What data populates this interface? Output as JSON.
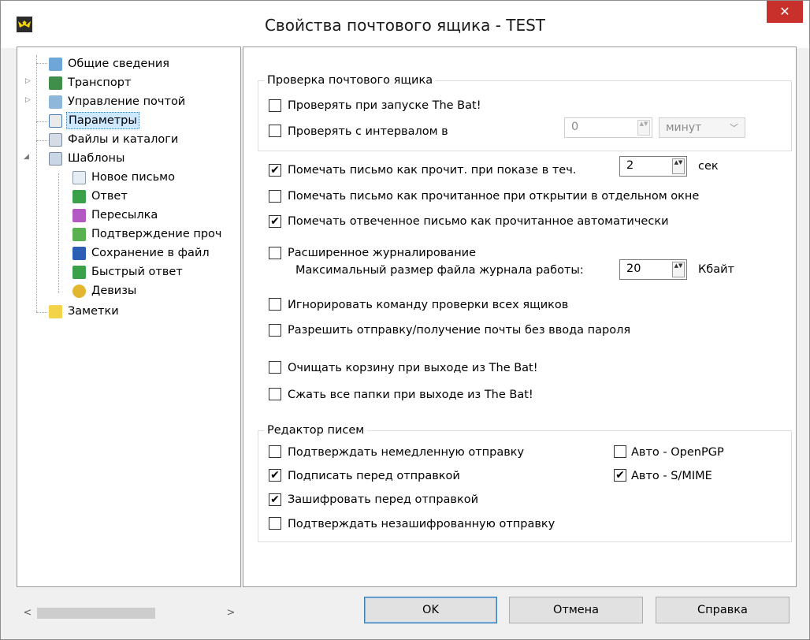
{
  "window": {
    "title": "Свойства почтового ящика - TEST",
    "close_glyph": "✕",
    "accent_close": "#c7302b"
  },
  "tree": {
    "items": [
      {
        "label": "Общие сведения",
        "icon": "general-info-icon"
      },
      {
        "label": "Транспорт",
        "icon": "transport-icon",
        "expander": "▷"
      },
      {
        "label": "Управление почтой",
        "icon": "mail-management-icon",
        "expander": "▷"
      },
      {
        "label": "Параметры",
        "icon": "parameters-icon",
        "selected": true
      },
      {
        "label": "Файлы и каталоги",
        "icon": "files-folders-icon"
      },
      {
        "label": "Шаблоны",
        "icon": "templates-icon",
        "expander": "◢"
      },
      {
        "label": "Новое письмо",
        "icon": "new-letter-icon"
      },
      {
        "label": "Ответ",
        "icon": "reply-icon"
      },
      {
        "label": "Пересылка",
        "icon": "forward-icon"
      },
      {
        "label": "Подтверждение проч",
        "icon": "read-confirmation-icon"
      },
      {
        "label": "Сохранение в файл",
        "icon": "save-to-file-icon"
      },
      {
        "label": "Быстрый ответ",
        "icon": "quick-reply-icon"
      },
      {
        "label": "Девизы",
        "icon": "mottos-icon"
      },
      {
        "label": "Заметки",
        "icon": "notes-icon"
      }
    ],
    "scroll_left": "<",
    "scroll_right": ">"
  },
  "check_mailbox": {
    "title": "Проверка почтового ящика",
    "on_startup": {
      "label": "Проверять при запуске The Bat!",
      "checked": false
    },
    "interval": {
      "label": "Проверять с интервалом в",
      "checked": false,
      "value": "0",
      "unit": "минут"
    }
  },
  "options": {
    "mark_read_on_show": {
      "label": "Помечать письмо как прочит. при показе в теч.",
      "checked": true,
      "value": "2",
      "unit": "сек"
    },
    "mark_read_separate_window": {
      "label": "Помечать письмо как прочитанное при открытии в отдельном окне",
      "checked": false
    },
    "mark_replied_read": {
      "label": "Помечать отвеченное письмо как прочитанное автоматически",
      "checked": true
    },
    "extended_logging": {
      "label": "Расширенное журналирование",
      "checked": false
    },
    "max_log_size": {
      "label": "Максимальный размер файла журнала работы:",
      "value": "20",
      "unit": "Кбайт"
    },
    "ignore_check_all": {
      "label": "Игнорировать команду проверки всех ящиков",
      "checked": false
    },
    "allow_no_password": {
      "label": "Разрешить отправку/получение почты без ввода пароля",
      "checked": false
    },
    "empty_trash": {
      "label": "Очищать корзину при выходе из The Bat!",
      "checked": false
    },
    "compress_folders": {
      "label": "Сжать все папки при выходе из The Bat!",
      "checked": false
    }
  },
  "editor": {
    "title": "Редактор писем",
    "confirm_immediate": {
      "label": "Подтверждать немедленную отправку",
      "checked": false
    },
    "sign_before_send": {
      "label": "Подписать перед отправкой",
      "checked": true
    },
    "encrypt_before_send": {
      "label": "Зашифровать перед отправкой",
      "checked": true
    },
    "confirm_unencrypted": {
      "label": "Подтверждать незашифрованную отправку",
      "checked": false
    },
    "auto_openpgp": {
      "label": "Авто - OpenPGP",
      "checked": false
    },
    "auto_smime": {
      "label": "Авто - S/MIME",
      "checked": true
    }
  },
  "buttons": {
    "ok": "OK",
    "cancel": "Отмена",
    "help": "Справка"
  },
  "glyphs": {
    "check": "✔",
    "spin": "▲▼",
    "combo_arrow": "﹀"
  }
}
